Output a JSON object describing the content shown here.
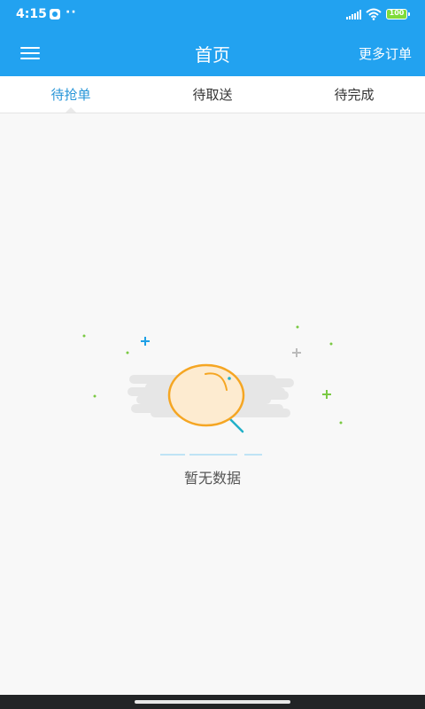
{
  "status_bar": {
    "time": "4:15",
    "dots": "··",
    "battery": "100"
  },
  "header": {
    "title": "首页",
    "more_orders": "更多订单"
  },
  "tabs": [
    {
      "label": "待抢单",
      "active": true
    },
    {
      "label": "待取送",
      "active": false
    },
    {
      "label": "待完成",
      "active": false
    }
  ],
  "empty_state": {
    "message": "暂无数据"
  },
  "colors": {
    "primary": "#22a2f0",
    "active_tab": "#2896d8",
    "magnifier_rim": "#f5a623",
    "magnifier_fill": "#fdebd0",
    "sparkle_green": "#7ac943",
    "sparkle_blue": "#1ea0e6"
  },
  "icons": {
    "menu": "hamburger-menu-icon",
    "empty": "magnifier-icon"
  }
}
